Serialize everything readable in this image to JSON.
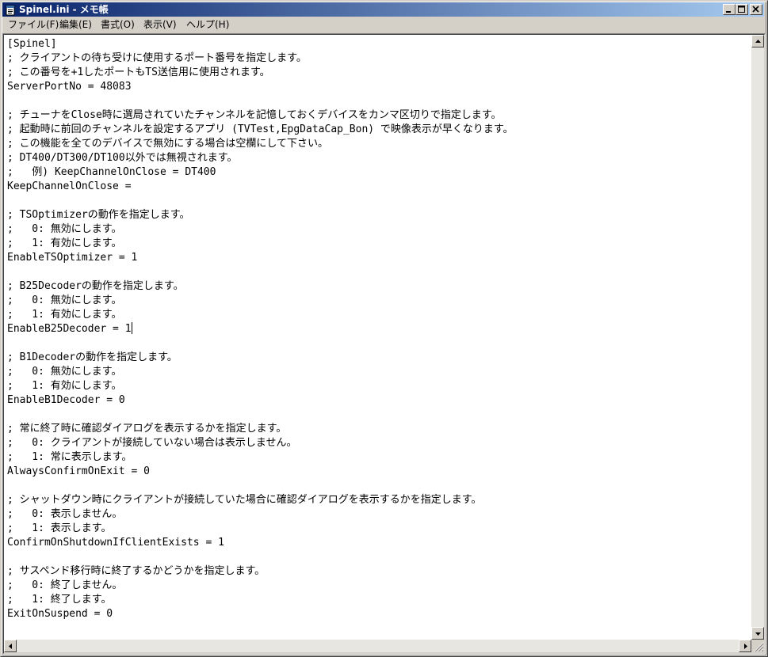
{
  "window": {
    "title": "Spinel.ini - メモ帳"
  },
  "menu": {
    "items": [
      "ファイル(F)",
      "編集(E)",
      "書式(O)",
      "表示(V)",
      "ヘルプ(H)"
    ]
  },
  "document": {
    "lines": [
      "[Spinel]",
      "; クライアントの待ち受けに使用するポート番号を指定します。",
      "; この番号を+1したポートもTS送信用に使用されます。",
      "ServerPortNo = 48083",
      "",
      "; チューナをClose時に選局されていたチャンネルを記憶しておくデバイスをカンマ区切りで指定します。",
      "; 起動時に前回のチャンネルを設定するアプリ (TVTest,EpgDataCap_Bon) で映像表示が早くなります。",
      "; この機能を全てのデバイスで無効にする場合は空欄にして下さい。",
      "; DT400/DT300/DT100以外では無視されます。",
      ";   例) KeepChannelOnClose = DT400",
      "KeepChannelOnClose =",
      "",
      "; TSOptimizerの動作を指定します。",
      ";   0: 無効にします。",
      ";   1: 有効にします。",
      "EnableTSOptimizer = 1",
      "",
      "; B25Decoderの動作を指定します。",
      ";   0: 無効にします。",
      ";   1: 有効にします。",
      "EnableB25Decoder = 1",
      "",
      "; B1Decoderの動作を指定します。",
      ";   0: 無効にします。",
      ";   1: 有効にします。",
      "EnableB1Decoder = 0",
      "",
      "; 常に終了時に確認ダイアログを表示するかを指定します。",
      ";   0: クライアントが接続していない場合は表示しません。",
      ";   1: 常に表示します。",
      "AlwaysConfirmOnExit = 0",
      "",
      "; シャットダウン時にクライアントが接続していた場合に確認ダイアログを表示するかを指定します。",
      ";   0: 表示しません。",
      ";   1: 表示します。",
      "ConfirmOnShutdownIfClientExists = 1",
      "",
      "; サスペンド移行時に終了するかどうかを指定します。",
      ";   0: 終了しません。",
      ";   1: 終了します。",
      "ExitOnSuspend = 0"
    ],
    "caret_line": 20
  },
  "icons": {
    "app": "notepad-icon",
    "minimize": "minimize-icon",
    "maximize": "maximize-icon",
    "close": "close-icon"
  }
}
